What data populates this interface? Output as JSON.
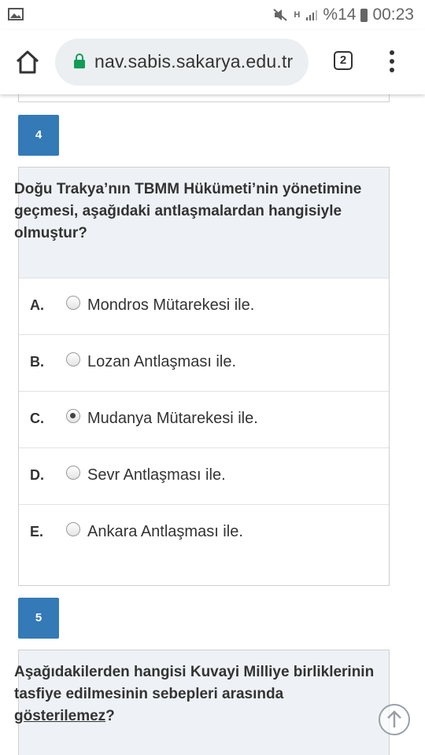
{
  "status_bar": {
    "battery_percent": "%14",
    "time": "00:23",
    "network_type": "H",
    "icons": [
      "gallery-icon",
      "mute-icon",
      "signal-icon",
      "battery-icon"
    ]
  },
  "browser": {
    "url": "nav.sabis.sakarya.edu.tr",
    "tab_count": "2",
    "icons": [
      "home-icon",
      "lock-icon",
      "tabs-icon",
      "menu-icon"
    ],
    "lock_color": "#0f9d58"
  },
  "questions": [
    {
      "number": "4",
      "text": "Doğu Trakya’nın TBMM Hükümeti’nin yönetimine geçmesi, aşağıdaki antlaşmalardan hangisiyle olmuştur?",
      "options": [
        {
          "letter": "A.",
          "text": "Mondros Mütarekesi ile.",
          "selected": false
        },
        {
          "letter": "B.",
          "text": "Lozan Antlaşması ile.",
          "selected": false
        },
        {
          "letter": "C.",
          "text": "Mudanya Mütarekesi ile.",
          "selected": true
        },
        {
          "letter": "D.",
          "text": "Sevr Antlaşması ile.",
          "selected": false
        },
        {
          "letter": "E.",
          "text": "Ankara Antlaşması ile.",
          "selected": false
        }
      ]
    },
    {
      "number": "5",
      "text_before": "Aşağıdakilerden hangisi Kuvayi Milliye birliklerinin tasfiye edilmesinin sebepleri arasında ",
      "text_underlined": "gösterilemez",
      "text_after": "?"
    }
  ],
  "colors": {
    "accent": "#337ab7",
    "question_header_bg": "#eef2f6",
    "card_border": "#cfcfcf"
  }
}
